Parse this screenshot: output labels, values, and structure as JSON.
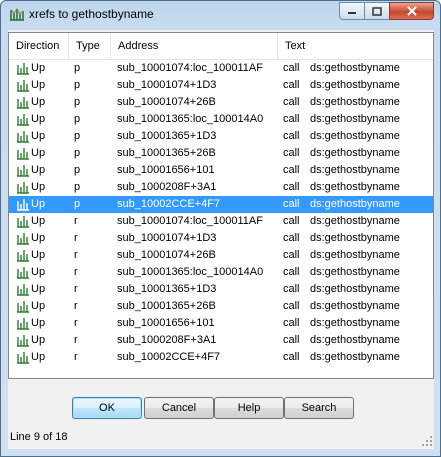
{
  "window": {
    "title": "xrefs to gethostbyname"
  },
  "columns": [
    "Direction",
    "Type",
    "Address",
    "Text"
  ],
  "rows": [
    {
      "dir": "Up",
      "type": "p",
      "addr": "sub_10001074:loc_100011AF",
      "t1": "call",
      "t2": "ds:gethostbyname"
    },
    {
      "dir": "Up",
      "type": "p",
      "addr": "sub_10001074+1D3",
      "t1": "call",
      "t2": "ds:gethostbyname"
    },
    {
      "dir": "Up",
      "type": "p",
      "addr": "sub_10001074+26B",
      "t1": "call",
      "t2": "ds:gethostbyname"
    },
    {
      "dir": "Up",
      "type": "p",
      "addr": "sub_10001365:loc_100014A0",
      "t1": "call",
      "t2": "ds:gethostbyname"
    },
    {
      "dir": "Up",
      "type": "p",
      "addr": "sub_10001365+1D3",
      "t1": "call",
      "t2": "ds:gethostbyname"
    },
    {
      "dir": "Up",
      "type": "p",
      "addr": "sub_10001365+26B",
      "t1": "call",
      "t2": "ds:gethostbyname"
    },
    {
      "dir": "Up",
      "type": "p",
      "addr": "sub_10001656+101",
      "t1": "call",
      "t2": "ds:gethostbyname"
    },
    {
      "dir": "Up",
      "type": "p",
      "addr": "sub_1000208F+3A1",
      "t1": "call",
      "t2": "ds:gethostbyname"
    },
    {
      "dir": "Up",
      "type": "p",
      "addr": "sub_10002CCE+4F7",
      "t1": "call",
      "t2": "ds:gethostbyname"
    },
    {
      "dir": "Up",
      "type": "r",
      "addr": "sub_10001074:loc_100011AF",
      "t1": "call",
      "t2": "ds:gethostbyname"
    },
    {
      "dir": "Up",
      "type": "r",
      "addr": "sub_10001074+1D3",
      "t1": "call",
      "t2": "ds:gethostbyname"
    },
    {
      "dir": "Up",
      "type": "r",
      "addr": "sub_10001074+26B",
      "t1": "call",
      "t2": "ds:gethostbyname"
    },
    {
      "dir": "Up",
      "type": "r",
      "addr": "sub_10001365:loc_100014A0",
      "t1": "call",
      "t2": "ds:gethostbyname"
    },
    {
      "dir": "Up",
      "type": "r",
      "addr": "sub_10001365+1D3",
      "t1": "call",
      "t2": "ds:gethostbyname"
    },
    {
      "dir": "Up",
      "type": "r",
      "addr": "sub_10001365+26B",
      "t1": "call",
      "t2": "ds:gethostbyname"
    },
    {
      "dir": "Up",
      "type": "r",
      "addr": "sub_10001656+101",
      "t1": "call",
      "t2": "ds:gethostbyname"
    },
    {
      "dir": "Up",
      "type": "r",
      "addr": "sub_1000208F+3A1",
      "t1": "call",
      "t2": "ds:gethostbyname"
    },
    {
      "dir": "Up",
      "type": "r",
      "addr": "sub_10002CCE+4F7",
      "t1": "call",
      "t2": "ds:gethostbyname"
    }
  ],
  "selected_row": 8,
  "buttons": {
    "ok": "OK",
    "cancel": "Cancel",
    "help": "Help",
    "search": "Search"
  },
  "status": "Line 9 of 18",
  "colors": {
    "selection": "#3399ff",
    "icon": "#2e7d32"
  }
}
